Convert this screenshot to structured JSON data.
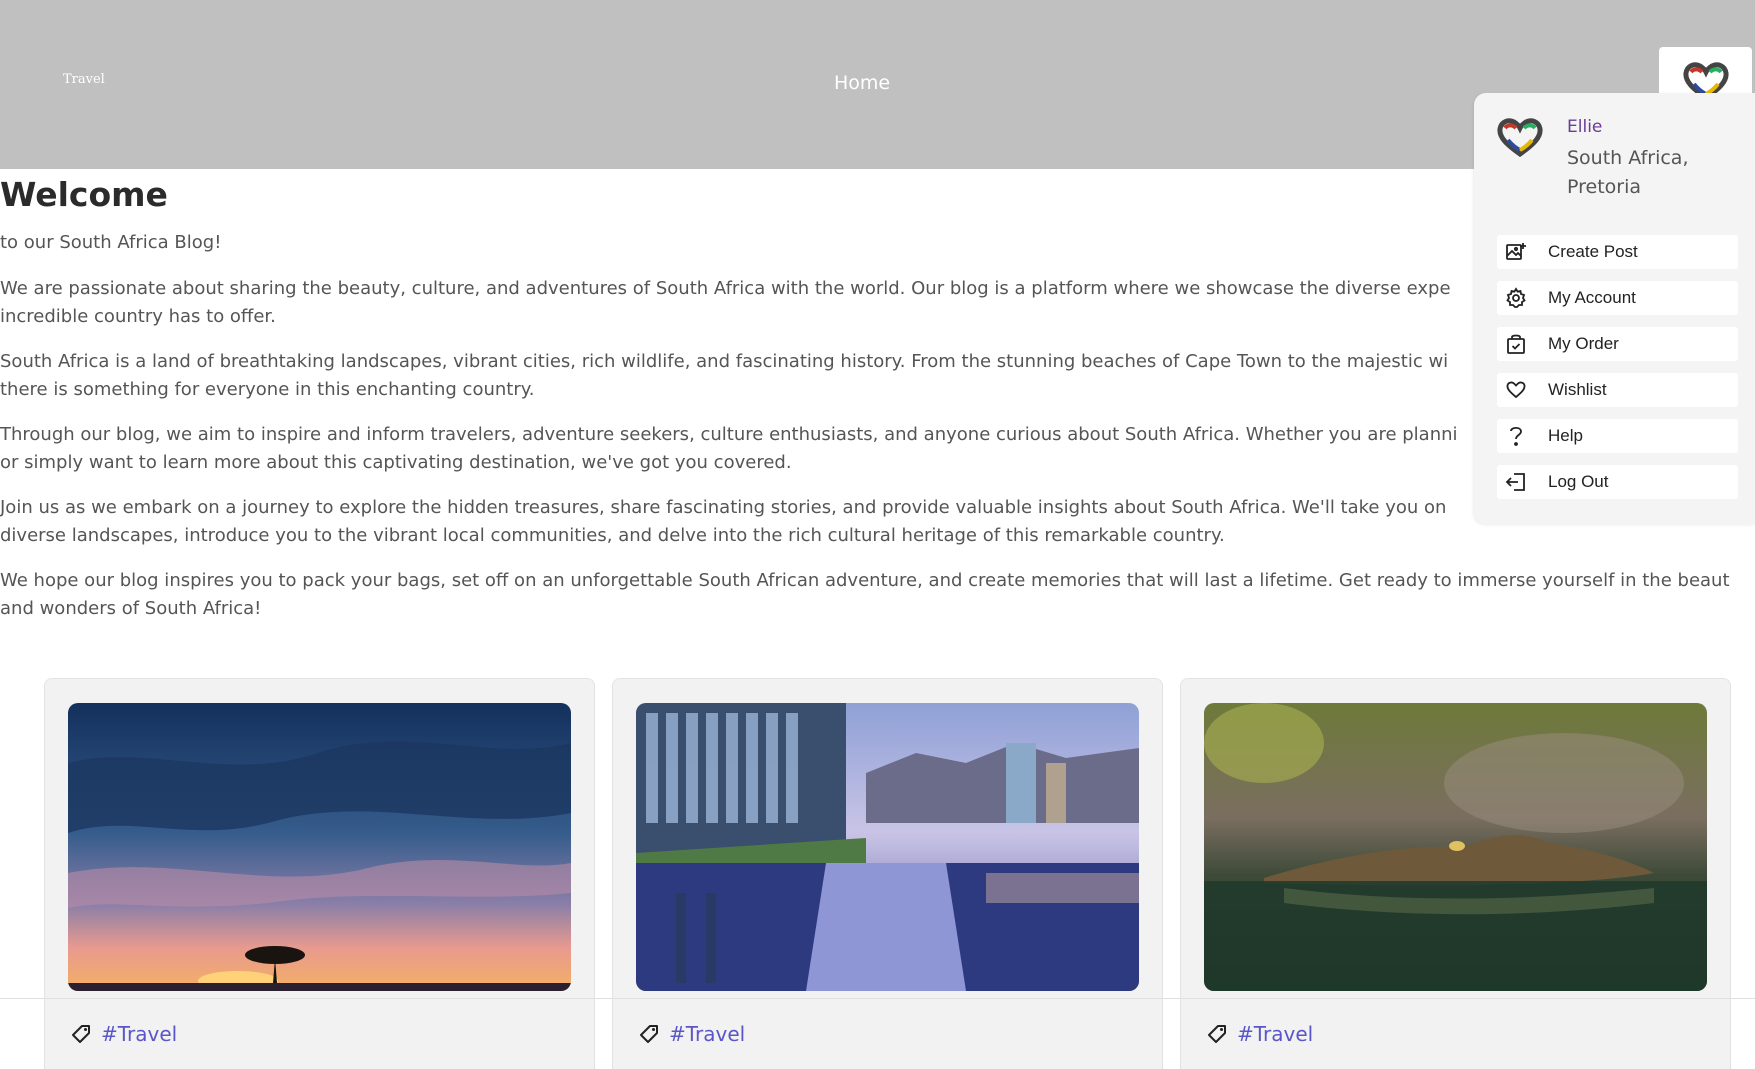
{
  "header": {
    "brand": "Travel",
    "nav_home": "Home"
  },
  "main": {
    "title": "Welcome",
    "subtitle": "to our South Africa Blog!",
    "paragraphs": [
      [
        "We are passionate about sharing the beauty, culture, and adventures of South Africa with the world. Our blog is a platform where we showcase the diverse expe",
        "incredible country has to offer."
      ],
      [
        "South Africa is a land of breathtaking landscapes, vibrant cities, rich wildlife, and fascinating history. From the stunning beaches of Cape Town to the majestic wi",
        "there is something for everyone in this enchanting country."
      ],
      [
        "Through our blog, we aim to inspire and inform travelers, adventure seekers, culture enthusiasts, and anyone curious about South Africa. Whether you are planni",
        "or simply want to learn more about this captivating destination, we've got you covered."
      ],
      [
        "Join us as we embark on a journey to explore the hidden treasures, share fascinating stories, and provide valuable insights about South Africa. We'll take you on",
        "diverse landscapes, introduce you to the vibrant local communities, and delve into the rich cultural heritage of this remarkable country."
      ],
      [
        "We hope our blog inspires you to pack your bags, set off on an unforgettable South African adventure, and create memories that will last a lifetime. Get ready to immerse yourself in the beaut",
        "and wonders of South Africa!"
      ]
    ]
  },
  "cards": [
    {
      "tag": "#Travel",
      "image": "savanna-sunset"
    },
    {
      "tag": "#Travel",
      "image": "cape-town-canal"
    },
    {
      "tag": "#Travel",
      "image": "crocodile-water"
    }
  ],
  "user_menu": {
    "name": "Ellie",
    "location": "South Africa, Pretoria",
    "items": [
      {
        "label": "Create Post",
        "icon": "image-plus-icon"
      },
      {
        "label": "My Account",
        "icon": "gear-icon"
      },
      {
        "label": "My Order",
        "icon": "shopping-bag-icon"
      },
      {
        "label": "Wishlist",
        "icon": "heart-icon"
      },
      {
        "label": "Help",
        "icon": "question-icon"
      },
      {
        "label": "Log Out",
        "icon": "logout-icon"
      }
    ]
  },
  "colors": {
    "header_bg": "#c0c0c0",
    "tag": "#5a55c8",
    "username": "#6a3c96"
  }
}
